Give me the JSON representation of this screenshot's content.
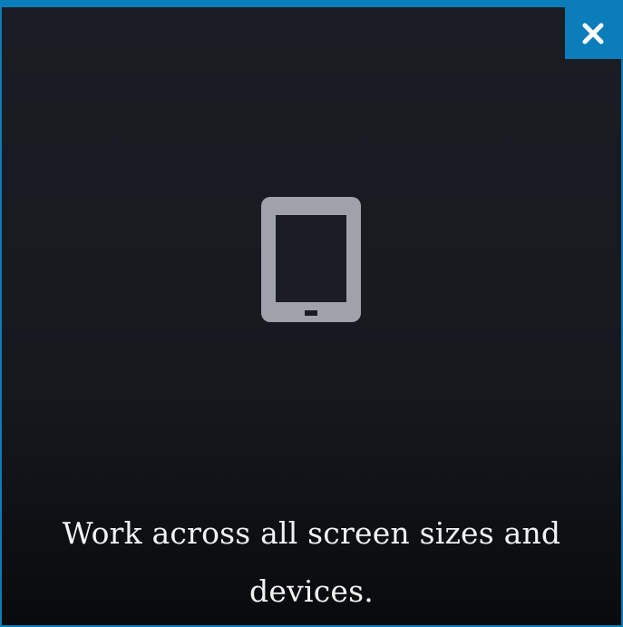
{
  "modal": {
    "caption": "Work across all screen sizes and devices.",
    "close_label": "✕",
    "icon": "tablet-icon",
    "colors": {
      "accent": "#0a7dba",
      "icon": "#9fa2aa",
      "text": "#f2f2f2",
      "background_top": "#1a1e24",
      "background_bottom": "#090a0c"
    }
  }
}
